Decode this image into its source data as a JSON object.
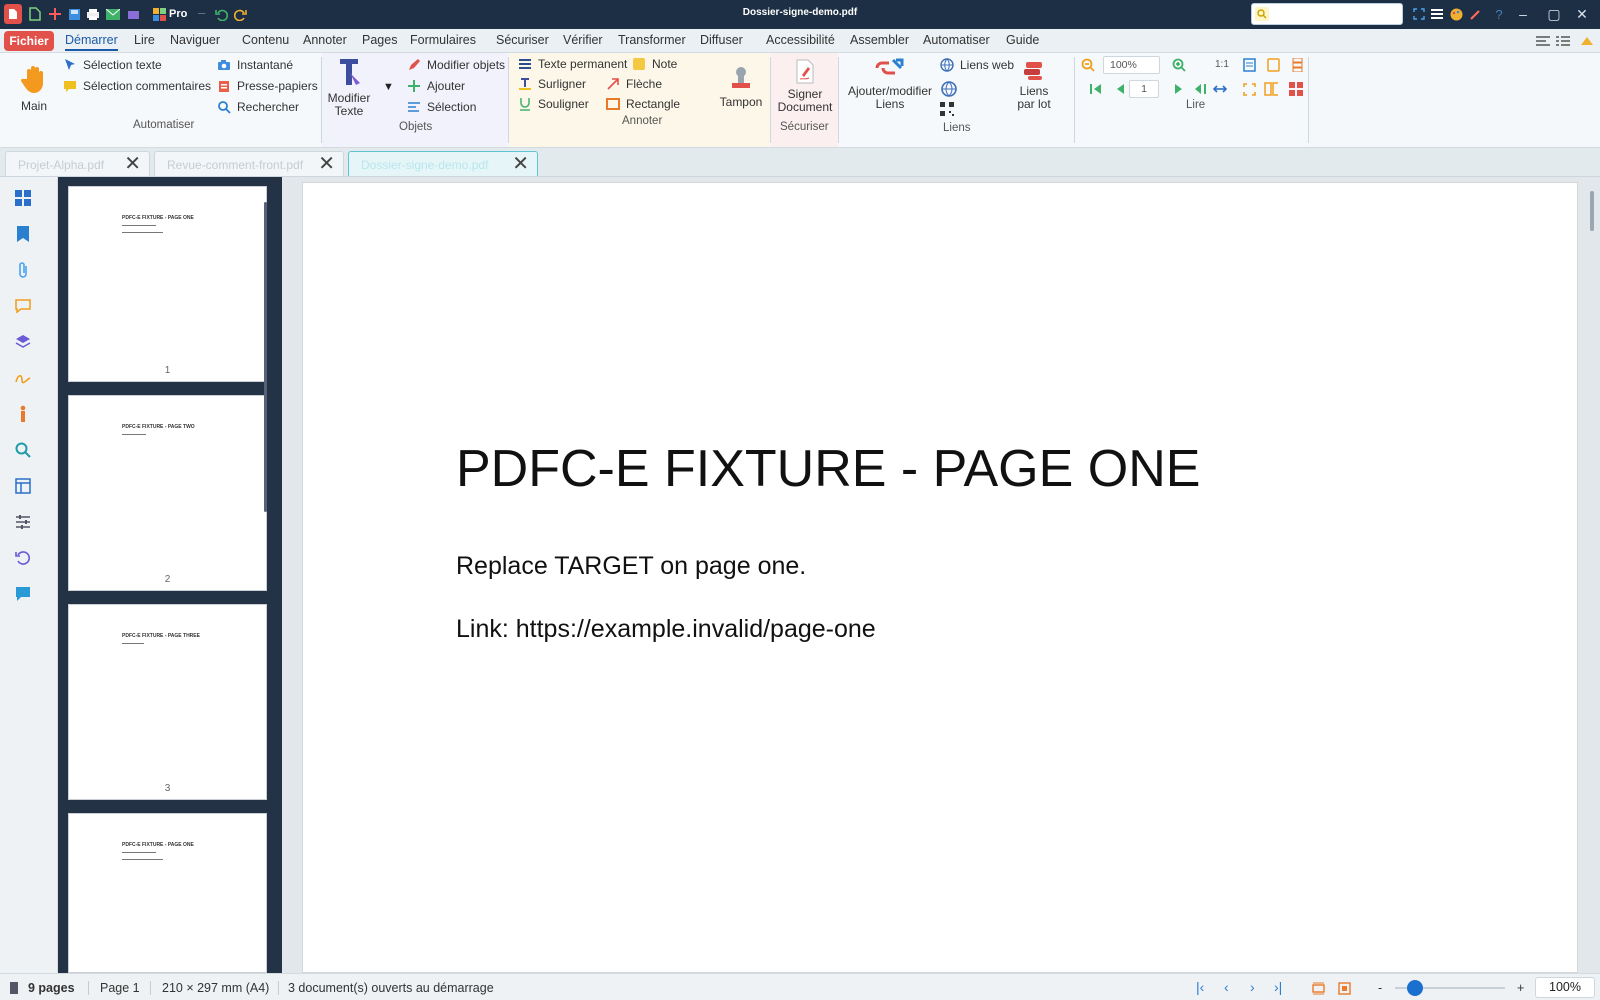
{
  "window": {
    "title": "Dossier-signe-demo.pdf",
    "pro_label": "Pro"
  },
  "menu": [
    "Démarrer",
    "Lire",
    "Naviguer",
    "Contenu",
    "Annoter",
    "Pages",
    "Formulaires",
    "Sécuriser",
    "Vérifier",
    "Transformer",
    "Diffuser",
    "Accessibilité",
    "Assembler",
    "Automatiser",
    "Guide"
  ],
  "file_menu": "Fichier",
  "ribbon": {
    "main_label": "Main",
    "selection_text": "Sélection texte",
    "selection_comments": "Sélection commentaires",
    "snapshot": "Instantané",
    "clipboard": "Presse-papiers",
    "search": "Rechercher",
    "group_automate": "Automatiser",
    "edit_text_1": "Modifier",
    "edit_text_2": "Texte",
    "edit_objects": "Modifier objets",
    "add": "Ajouter",
    "selection": "Sélection",
    "group_objects": "Objets",
    "permanent_text": "Texte permanent",
    "highlight": "Surligner",
    "underline": "Souligner",
    "note": "Note",
    "arrow": "Flèche",
    "rectangle": "Rectangle",
    "stamp": "Tampon",
    "group_annotate": "Annoter",
    "sign_1": "Signer",
    "sign_2": "Document",
    "group_secure": "Sécuriser",
    "links_1": "Ajouter/modifier",
    "links_2": "Liens",
    "web_links": "Liens web",
    "batch_links_1": "Liens",
    "batch_links_2": "par lot",
    "group_links": "Liens",
    "zoom_value": "100%",
    "page_value": "1",
    "ratio_label": "1:1",
    "group_read": "Lire"
  },
  "tabs": [
    {
      "label": "Projet-Alpha.pdf"
    },
    {
      "label": "Revue-comment-front.pdf"
    },
    {
      "label": "Dossier-signe-demo.pdf"
    }
  ],
  "thumbnails": [
    {
      "title": "PDFC-E FIXTURE - PAGE ONE",
      "num": "1"
    },
    {
      "title": "PDFC-E FIXTURE - PAGE TWO",
      "num": "2"
    },
    {
      "title": "PDFC-E FIXTURE - PAGE THREE",
      "num": "3"
    },
    {
      "title": "PDFC-E FIXTURE - PAGE ONE",
      "num": ""
    }
  ],
  "page": {
    "title": "PDFC-E FIXTURE - PAGE ONE",
    "line1": "Replace TARGET on page one.",
    "line2": "Link: https://example.invalid/page-one"
  },
  "status": {
    "pages": "9 pages",
    "current": "Page 1",
    "size": "210 × 297 mm (A4)",
    "docs": "3 document(s) ouverts au démarrage",
    "zoom": "100%",
    "zoom_minus": "-",
    "zoom_plus": "+"
  },
  "colors": {
    "accent": "#1b5aa8",
    "file_button": "#e2504a",
    "titlebar": "#1d2f44",
    "thumb_panel": "#243246"
  }
}
